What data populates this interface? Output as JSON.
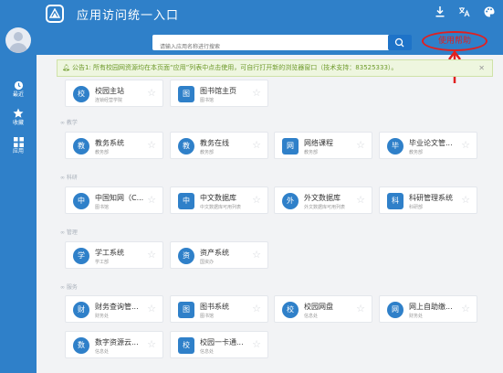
{
  "app": {
    "title": "应用访问统一入口"
  },
  "sidebar": [
    {
      "label": "最近",
      "icon": "clock-icon"
    },
    {
      "label": "收藏",
      "icon": "star-icon"
    },
    {
      "label": "应用",
      "icon": "grid-icon"
    }
  ],
  "topbar": {
    "icons": [
      "download-icon",
      "translate-icon",
      "palette-icon"
    ]
  },
  "search": {
    "placeholder": "请输入应用名称进行搜索"
  },
  "help": {
    "label": "使用帮助"
  },
  "notice": {
    "text": "公告1: 所有校园网资源均在本页面“应用”列表中点击使用，可自行打开新的浏览器窗口（技术支持：83525333）。"
  },
  "sections": [
    {
      "title": "",
      "items": [
        {
          "badge": "校",
          "name": "校园主站",
          "sub": "连锁经营学院"
        },
        {
          "badge": "图",
          "name": "图书馆主页",
          "sub": "图书馆"
        }
      ]
    },
    {
      "title": "教学",
      "items": [
        {
          "badge": "教",
          "name": "教务系统",
          "sub": "教务部"
        },
        {
          "badge": "教",
          "name": "教务在线",
          "sub": "教务部"
        },
        {
          "badge": "网",
          "name": "网络课程",
          "sub": "教务部"
        },
        {
          "badge": "毕",
          "name": "毕业论文管...",
          "sub": "教务部"
        }
      ]
    },
    {
      "title": "科研",
      "items": [
        {
          "badge": "中",
          "name": "中国知网（C...",
          "sub": "图书馆"
        },
        {
          "badge": "中",
          "name": "中文数据库",
          "sub": "中文数据库可用列表"
        },
        {
          "badge": "外",
          "name": "外文数据库",
          "sub": "外文数据库可用列表"
        },
        {
          "badge": "科",
          "name": "科研管理系统",
          "sub": "科研部"
        }
      ]
    },
    {
      "title": "管理",
      "items": [
        {
          "badge": "学",
          "name": "学工系统",
          "sub": "学工部"
        },
        {
          "badge": "资",
          "name": "资产系统",
          "sub": "国资办"
        }
      ]
    },
    {
      "title": "服务",
      "items": [
        {
          "badge": "财",
          "name": "财务查询管...",
          "sub": "财务处"
        },
        {
          "badge": "图",
          "name": "图书系统",
          "sub": "图书馆"
        },
        {
          "badge": "校",
          "name": "校园网盘",
          "sub": "信息处"
        },
        {
          "badge": "网",
          "name": "网上自助缴...",
          "sub": "财务处"
        },
        {
          "badge": "数",
          "name": "数字资源云...",
          "sub": "信息处"
        },
        {
          "badge": "校",
          "name": "校园一卡通...",
          "sub": "信息处"
        }
      ]
    }
  ],
  "colors": {
    "primary": "#2f80c9",
    "badge": "#2f80c9",
    "help": "#e02020",
    "notice_bg": "#eef6df"
  }
}
